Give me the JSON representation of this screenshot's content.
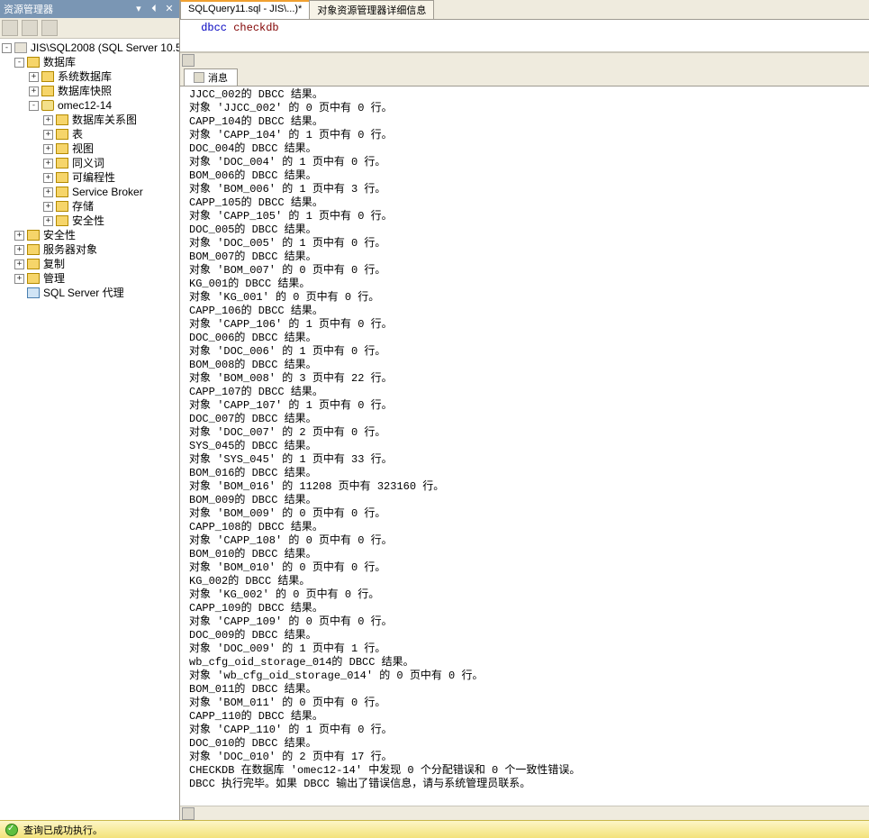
{
  "sidebar": {
    "title": "资源管理器",
    "server": "JIS\\SQL2008 (SQL Server 10.50.",
    "nodes": [
      {
        "indent": 0,
        "exp": "-",
        "icon": "server",
        "label": "JIS\\SQL2008 (SQL Server 10.50."
      },
      {
        "indent": 1,
        "exp": "-",
        "icon": "folder",
        "label": "数据库"
      },
      {
        "indent": 2,
        "exp": "+",
        "icon": "folder",
        "label": "系统数据库"
      },
      {
        "indent": 2,
        "exp": "+",
        "icon": "folder",
        "label": "数据库快照"
      },
      {
        "indent": 2,
        "exp": "-",
        "icon": "db",
        "label": "omec12-14"
      },
      {
        "indent": 3,
        "exp": "+",
        "icon": "folder",
        "label": "数据库关系图"
      },
      {
        "indent": 3,
        "exp": "+",
        "icon": "folder",
        "label": "表"
      },
      {
        "indent": 3,
        "exp": "+",
        "icon": "folder",
        "label": "视图"
      },
      {
        "indent": 3,
        "exp": "+",
        "icon": "folder",
        "label": "同义词"
      },
      {
        "indent": 3,
        "exp": "+",
        "icon": "folder",
        "label": "可编程性"
      },
      {
        "indent": 3,
        "exp": "+",
        "icon": "folder",
        "label": "Service Broker"
      },
      {
        "indent": 3,
        "exp": "+",
        "icon": "folder",
        "label": "存储"
      },
      {
        "indent": 3,
        "exp": "+",
        "icon": "folder",
        "label": "安全性"
      },
      {
        "indent": 1,
        "exp": "+",
        "icon": "folder",
        "label": "安全性"
      },
      {
        "indent": 1,
        "exp": "+",
        "icon": "folder",
        "label": "服务器对象"
      },
      {
        "indent": 1,
        "exp": "+",
        "icon": "folder",
        "label": "复制"
      },
      {
        "indent": 1,
        "exp": "+",
        "icon": "folder",
        "label": "管理"
      },
      {
        "indent": 1,
        "exp": " ",
        "icon": "agent",
        "label": "SQL Server 代理"
      }
    ]
  },
  "tabs": [
    {
      "label": "SQLQuery11.sql - JIS\\...)*",
      "active": true
    },
    {
      "label": "对象资源管理器详细信息",
      "active": false
    }
  ],
  "editor": {
    "kw1": "dbcc",
    "kw2": "checkdb"
  },
  "messages_tab": "消息",
  "messages": [
    "JJCC_002的 DBCC 结果。",
    "对象 'JJCC_002' 的 0 页中有 0 行。",
    "CAPP_104的 DBCC 结果。",
    "对象 'CAPP_104' 的 1 页中有 0 行。",
    "DOC_004的 DBCC 结果。",
    "对象 'DOC_004' 的 1 页中有 0 行。",
    "BOM_006的 DBCC 结果。",
    "对象 'BOM_006' 的 1 页中有 3 行。",
    "CAPP_105的 DBCC 结果。",
    "对象 'CAPP_105' 的 1 页中有 0 行。",
    "DOC_005的 DBCC 结果。",
    "对象 'DOC_005' 的 1 页中有 0 行。",
    "BOM_007的 DBCC 结果。",
    "对象 'BOM_007' 的 0 页中有 0 行。",
    "KG_001的 DBCC 结果。",
    "对象 'KG_001' 的 0 页中有 0 行。",
    "CAPP_106的 DBCC 结果。",
    "对象 'CAPP_106' 的 1 页中有 0 行。",
    "DOC_006的 DBCC 结果。",
    "对象 'DOC_006' 的 1 页中有 0 行。",
    "BOM_008的 DBCC 结果。",
    "对象 'BOM_008' 的 3 页中有 22 行。",
    "CAPP_107的 DBCC 结果。",
    "对象 'CAPP_107' 的 1 页中有 0 行。",
    "DOC_007的 DBCC 结果。",
    "对象 'DOC_007' 的 2 页中有 0 行。",
    "SYS_045的 DBCC 结果。",
    "对象 'SYS_045' 的 1 页中有 33 行。",
    "BOM_016的 DBCC 结果。",
    "对象 'BOM_016' 的 11208 页中有 323160 行。",
    "BOM_009的 DBCC 结果。",
    "对象 'BOM_009' 的 0 页中有 0 行。",
    "CAPP_108的 DBCC 结果。",
    "对象 'CAPP_108' 的 0 页中有 0 行。",
    "BOM_010的 DBCC 结果。",
    "对象 'BOM_010' 的 0 页中有 0 行。",
    "KG_002的 DBCC 结果。",
    "对象 'KG_002' 的 0 页中有 0 行。",
    "CAPP_109的 DBCC 结果。",
    "对象 'CAPP_109' 的 0 页中有 0 行。",
    "DOC_009的 DBCC 结果。",
    "对象 'DOC_009' 的 1 页中有 1 行。",
    "wb_cfg_oid_storage_014的 DBCC 结果。",
    "对象 'wb_cfg_oid_storage_014' 的 0 页中有 0 行。",
    "BOM_011的 DBCC 结果。",
    "对象 'BOM_011' 的 0 页中有 0 行。",
    "CAPP_110的 DBCC 结果。",
    "对象 'CAPP_110' 的 1 页中有 0 行。",
    "DOC_010的 DBCC 结果。",
    "对象 'DOC_010' 的 2 页中有 17 行。",
    "CHECKDB 在数据库 'omec12-14' 中发现 0 个分配错误和 0 个一致性错误。",
    "DBCC 执行完毕。如果 DBCC 输出了错误信息，请与系统管理员联系。"
  ],
  "status": "查询已成功执行。"
}
